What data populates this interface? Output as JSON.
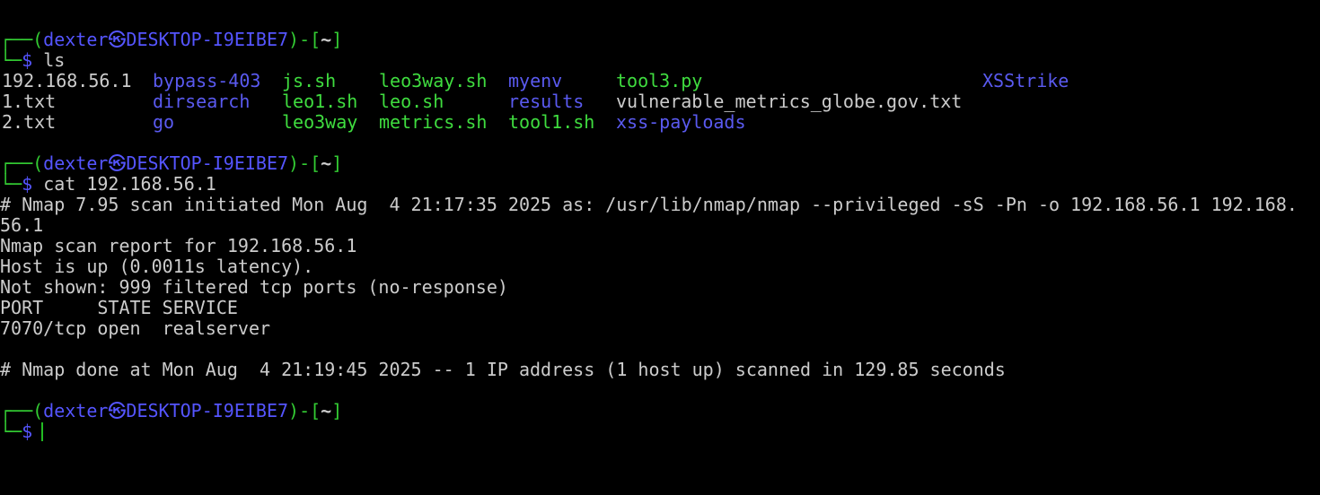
{
  "prompt": {
    "box_top": "┌──",
    "box_bottom": "└─",
    "open_paren": "(",
    "user": "dexter",
    "at_symbol": "㉿",
    "host": "DESKTOP-I9EIBE7",
    "close_dash_bracket": ")-[",
    "cwd": "~",
    "close_bracket": "]",
    "dollar": "$"
  },
  "commands": {
    "ls": "ls",
    "cat": "cat 192.168.56.1"
  },
  "ls_output": {
    "row1": [
      "192.168.56.1",
      "bypass-403",
      "js.sh",
      "leo3way.sh",
      "myenv",
      "tool3.py",
      "XSStrike"
    ],
    "row2": [
      "1.txt",
      "dirsearch",
      "leo1.sh",
      "leo.sh",
      "results",
      "vulnerable_metrics_globe.gov.txt"
    ],
    "row3": [
      "2.txt",
      "go",
      "leo3way",
      "metrics.sh",
      "tool1.sh",
      "xss-payloads"
    ]
  },
  "cat_output": [
    "# Nmap 7.95 scan initiated Mon Aug  4 21:17:35 2025 as: /usr/lib/nmap/nmap --privileged -sS -Pn -o 192.168.56.1 192.168.",
    "56.1",
    "Nmap scan report for 192.168.56.1",
    "Host is up (0.0011s latency).",
    "Not shown: 999 filtered tcp ports (no-response)",
    "PORT     STATE SERVICE",
    "7070/tcp open  realserver",
    "",
    "# Nmap done at Mon Aug  4 21:19:45 2025 -- 1 IP address (1 host up) scanned in 129.85 seconds"
  ],
  "colors": {
    "background": "#000000",
    "prompt_green": "#33cc33",
    "prompt_blue": "#5555ff",
    "text": "#cccccc",
    "executable": "#3fdc3f",
    "directory": "#5a5af0"
  }
}
